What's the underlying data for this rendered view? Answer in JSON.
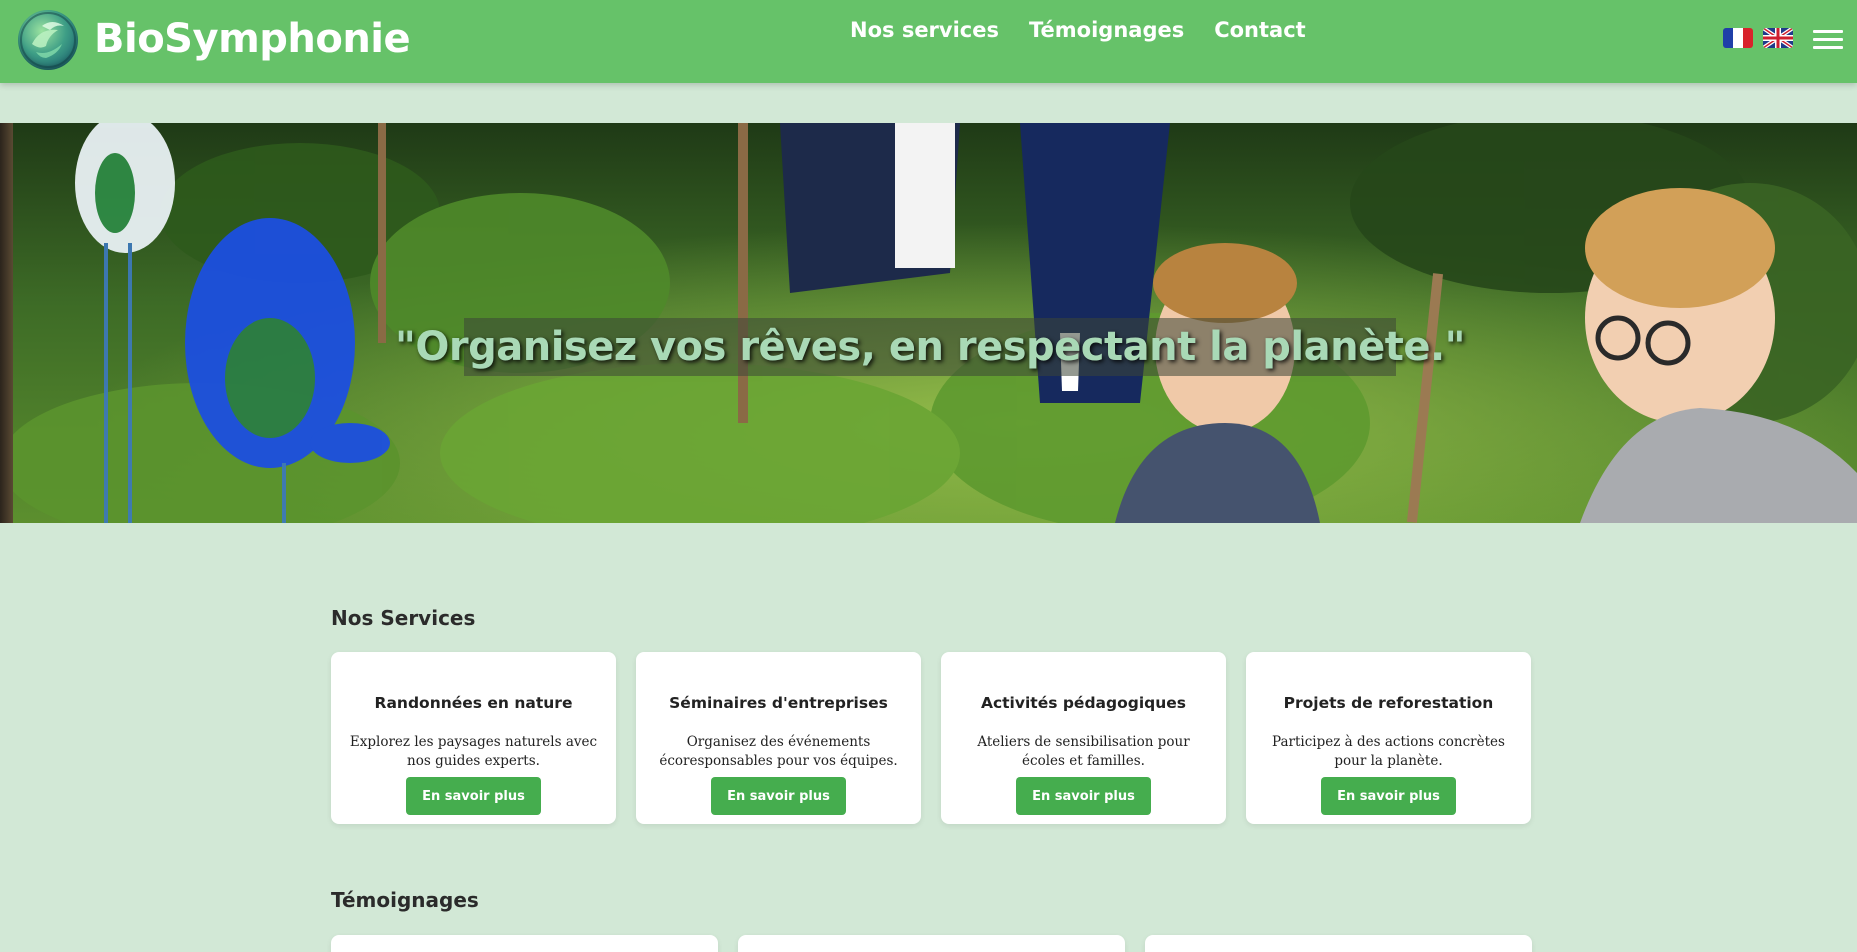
{
  "header": {
    "brand": "BioSymphonie",
    "logo_icon": "leaf-globe-icon",
    "nav": [
      {
        "label": "Nos services"
      },
      {
        "label": "Témoignages"
      },
      {
        "label": "Contact"
      }
    ],
    "languages": [
      {
        "code": "fr",
        "icon": "french-flag-icon"
      },
      {
        "code": "en",
        "icon": "uk-flag-icon"
      }
    ],
    "menu_icon": "hamburger-menu-icon",
    "background_color": "#66c269"
  },
  "hero": {
    "quote": "\"Organisez vos rêves, en respectant la planète.\""
  },
  "services": {
    "title": "Nos Services",
    "items": [
      {
        "title": "Randonnées en nature",
        "description": "Explorez les paysages naturels avec nos guides experts.",
        "button": "En savoir plus"
      },
      {
        "title": "Séminaires d'entreprises",
        "description": "Organisez des événements écoresponsables pour vos équipes.",
        "button": "En savoir plus"
      },
      {
        "title": "Activités pédagogiques",
        "description": "Ateliers de sensibilisation pour écoles et familles.",
        "button": "En savoir plus"
      },
      {
        "title": "Projets de reforestation",
        "description": "Participez à des actions concrètes pour la planète.",
        "button": "En savoir plus"
      }
    ],
    "button_color": "#45ad4e"
  },
  "testimonials": {
    "title": "Témoignages"
  },
  "page_background": "#d2e8d6"
}
